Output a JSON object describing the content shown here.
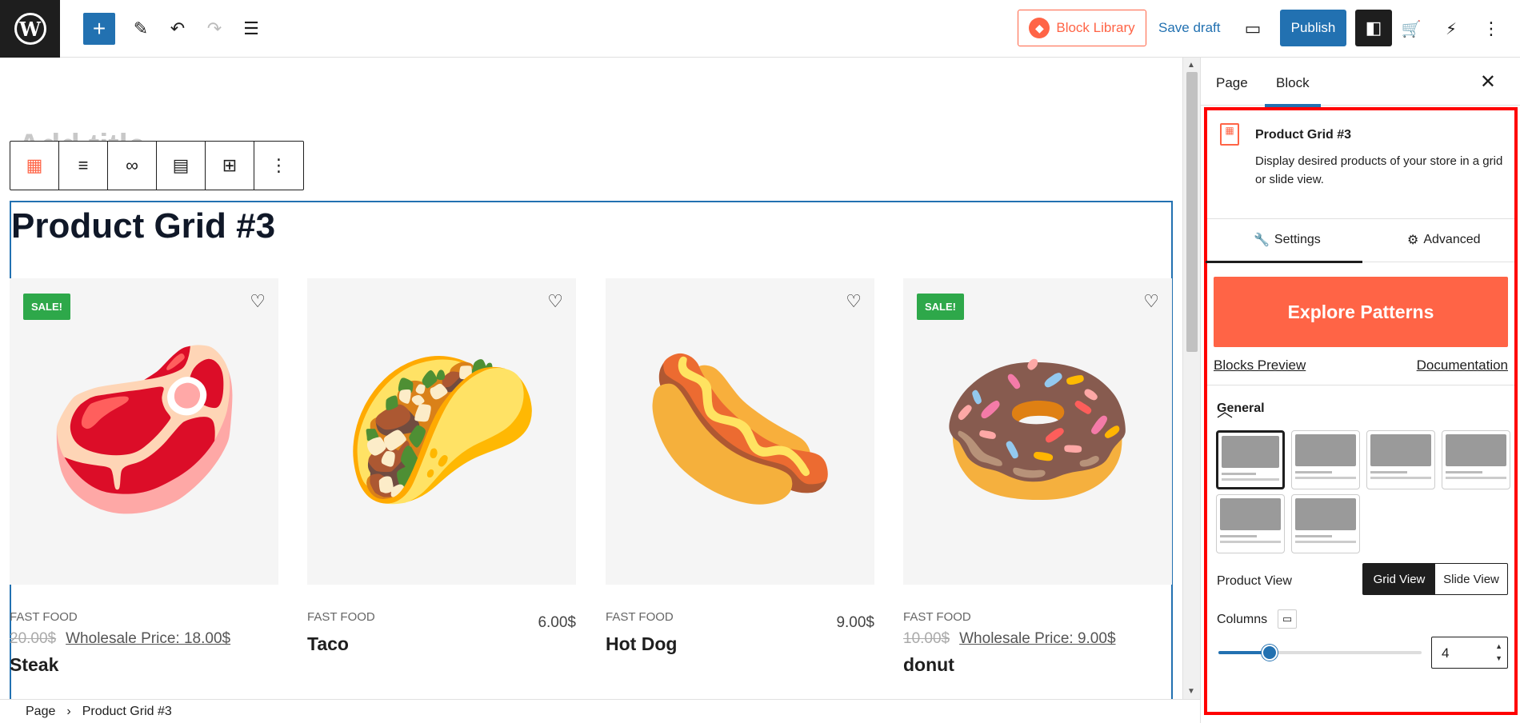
{
  "topbar": {
    "logo": "W",
    "add_icon": "+",
    "tools_icon": "✎",
    "undo_icon": "↶",
    "redo_icon": "↷",
    "list_icon": "☰",
    "block_library_label": "Block Library",
    "save_draft_label": "Save draft",
    "preview_icon": "▭",
    "publish_label": "Publish",
    "sidebar_icon": "◧",
    "cart_icon": "🛒",
    "plugin_icon": "⚡",
    "more_icon": "⋮"
  },
  "editor": {
    "ghost_title": "Add title",
    "toolbar": [
      "▦",
      "≡",
      "∞",
      "▤",
      "⊞",
      "⋮"
    ],
    "block_heading": "Product Grid #3",
    "products": [
      {
        "category": "FAST FOOD",
        "sale": "SALE!",
        "old_price": "20.00$",
        "wholesale": "Wholesale Price: 18.00$",
        "price": "",
        "name": "Steak",
        "stars": "☆☆☆☆☆",
        "emoji": "🥩"
      },
      {
        "category": "FAST FOOD",
        "sale": "",
        "old_price": "",
        "wholesale": "",
        "price": "6.00$",
        "name": "Taco",
        "stars": "☆☆☆☆☆",
        "emoji": "🌮"
      },
      {
        "category": "FAST FOOD",
        "sale": "",
        "old_price": "",
        "wholesale": "",
        "price": "9.00$",
        "name": "Hot Dog",
        "stars": "☆☆☆☆☆",
        "emoji": "🌭"
      },
      {
        "category": "FAST FOOD",
        "sale": "SALE!",
        "old_price": "10.00$",
        "wholesale": "Wholesale Price: 9.00$",
        "price": "",
        "name": "donut",
        "stars": "☆☆☆☆☆",
        "emoji": "🍩"
      }
    ],
    "heart_icon": "♡"
  },
  "statusbar": {
    "crumb_page": "Page",
    "sep": "›",
    "crumb_block": "Product Grid #3"
  },
  "sidebar": {
    "tab_page": "Page",
    "tab_block": "Block",
    "close_icon": "✕",
    "block_title": "Product Grid #3",
    "block_desc": "Display desired products of your store in a grid or slide view.",
    "settings_tab": "Settings",
    "advanced_tab": "Advanced",
    "explore_label": "Explore Patterns",
    "blocks_preview": "Blocks Preview",
    "documentation": "Documentation",
    "general_label": "General",
    "product_view_label": "Product View",
    "grid_view": "Grid View",
    "slide_view": "Slide View",
    "columns_label": "Columns",
    "columns_value": "4",
    "columns_slider_fraction": 0.25
  },
  "colors": {
    "accent": "#2271b1",
    "brand": "#ff6446",
    "sale": "#2ea84a",
    "highlight": "#ff0000"
  }
}
